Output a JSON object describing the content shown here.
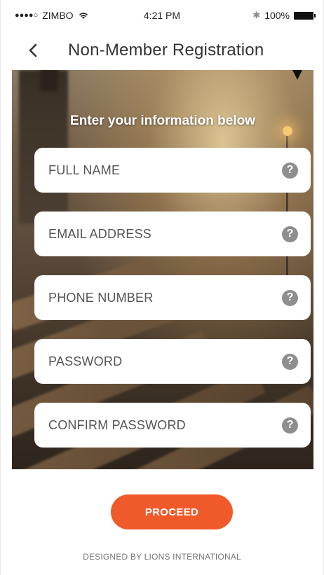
{
  "status_bar": {
    "signal": "●●●●○",
    "carrier": "ZIMBO",
    "time": "4:21 PM",
    "battery": "100%",
    "bluetooth_symbol": "✱"
  },
  "nav": {
    "back_icon": "chevron-left-icon",
    "title": "Non-Member Registration"
  },
  "form": {
    "heading": "Enter your information below",
    "fields": [
      {
        "label": "FULL NAME",
        "help": "?"
      },
      {
        "label": "EMAIL ADDRESS",
        "help": "?"
      },
      {
        "label": "PHONE NUMBER",
        "help": "?"
      },
      {
        "label": "PASSWORD",
        "help": "?"
      },
      {
        "label": "CONFIRM PASSWORD",
        "help": "?"
      }
    ]
  },
  "actions": {
    "proceed_label": "PROCEED"
  },
  "footer": {
    "credit": "DESIGNED BY LIONS INTERNATIONAL"
  },
  "colors": {
    "accent": "#f05a2a",
    "help_icon": "#8e8e8e",
    "title_text": "#333333"
  }
}
